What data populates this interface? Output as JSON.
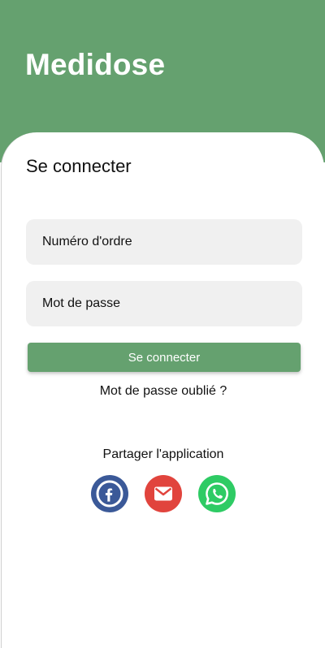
{
  "header": {
    "app_title": "Medidose"
  },
  "login": {
    "title": "Se connecter",
    "ordre_placeholder": "Numéro d'ordre",
    "password_placeholder": "Mot de passe",
    "submit_label": "Se connecter",
    "forgot_label": "Mot de passe oublié ?"
  },
  "share": {
    "label": "Partager l'application",
    "buttons": [
      {
        "icon": "facebook-icon",
        "color": "#3b5998"
      },
      {
        "icon": "email-icon",
        "color": "#e1443d"
      },
      {
        "icon": "whatsapp-icon",
        "color": "#2ecb64"
      }
    ]
  },
  "colors": {
    "primary": "#65a16f",
    "field_bg": "#f0f0f0"
  }
}
